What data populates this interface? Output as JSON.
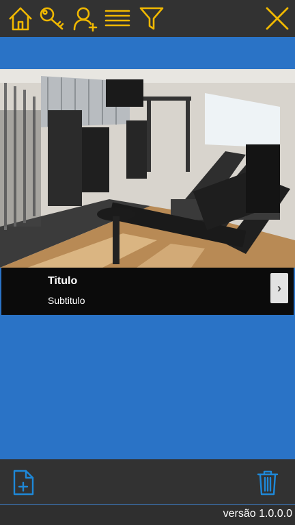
{
  "colors": {
    "toolbar_bg": "#323232",
    "accent_icon": "#f0b800",
    "main_bg": "#2a73c6",
    "bottom_icon": "#1e88d8",
    "caption_bg": "#0b0b0b"
  },
  "toolbar": {
    "icons": [
      "home-icon",
      "key-icon",
      "add-user-icon",
      "list-icon",
      "filter-icon",
      "close-icon"
    ]
  },
  "card": {
    "image_alt": "gym-photo",
    "title": "Titulo",
    "subtitle": "Subtitulo",
    "arrow_glyph": "›"
  },
  "bottom": {
    "icons": [
      "new-document-icon",
      "trash-icon"
    ]
  },
  "footer": {
    "version": "versão 1.0.0.0"
  }
}
